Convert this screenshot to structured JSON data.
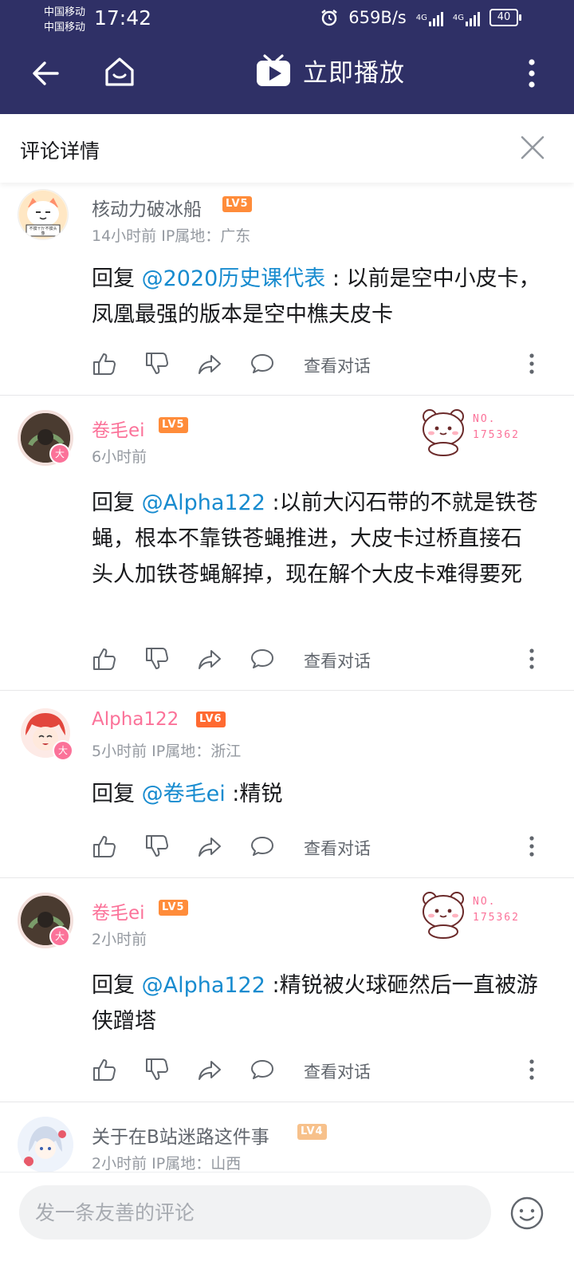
{
  "status_bar": {
    "carrier_1": "中国移动",
    "carrier_2": "中国移动",
    "time": "17:42",
    "speed": "659B/s",
    "network_1": "4G",
    "network_2": "4G",
    "battery": "40"
  },
  "app_bar": {
    "title": "立即播放",
    "back_icon": "back-arrow-icon",
    "home_icon": "home-icon",
    "tv_icon": "tv-play-icon",
    "more_icon": "more-vertical-icon"
  },
  "panel": {
    "title": "评论详情",
    "close_icon": "close-icon"
  },
  "comments": [
    {
      "username": "核动力破冰船",
      "level": "LV5",
      "meta": "14小时前  IP属地：广东",
      "reply_prefix": "回复 ",
      "mention": "@2020历史课代表",
      "text": " : 以前是空中小皮卡，凤凰最强的版本是空中樵夫皮卡",
      "view_dialog": "查看对话",
      "avatar_caption": "不摸十斤不摸头像"
    },
    {
      "username": "卷毛ei",
      "level": "LV5",
      "meta": "6小时前",
      "reply_prefix": "回复 ",
      "mention": "@Alpha122",
      "text": " :以前大闪石带的不就是铁苍蝇，根本不靠铁苍蝇推进，大皮卡过桥直接石头人加铁苍蝇解掉，现在解个大皮卡难得要死",
      "view_dialog": "查看对话",
      "badge": "大",
      "fan_no_label": "NO.",
      "fan_no": "175362"
    },
    {
      "username": "Alpha122",
      "level": "LV6",
      "meta": "5小时前  IP属地：浙江",
      "reply_prefix": "回复 ",
      "mention": "@卷毛ei",
      "text": " :精锐",
      "view_dialog": "查看对话",
      "badge": "大"
    },
    {
      "username": "卷毛ei",
      "level": "LV5",
      "meta": "2小时前",
      "reply_prefix": "回复 ",
      "mention": "@Alpha122",
      "text": " :精锐被火球砸然后一直被游侠蹭塔",
      "view_dialog": "查看对话",
      "badge": "大",
      "fan_no_label": "NO.",
      "fan_no": "175362"
    },
    {
      "username": "关于在B站迷路这件事",
      "level": "LV4",
      "meta": "2小时前  IP属地：山西"
    }
  ],
  "action_icons": [
    "thumb-up-icon",
    "thumb-down-icon",
    "share-icon",
    "comment-icon",
    "more-vertical-icon"
  ],
  "bottom_bar": {
    "placeholder": "发一条友善的评论",
    "emoji_icon": "emoji-icon"
  },
  "colors": {
    "app_bar": "#2f3066",
    "vip_name": "#fb7299",
    "mention": "#178bcf",
    "lv4": "#f7c18b",
    "lv5": "#ff8c3a",
    "lv6": "#ff6a31"
  }
}
